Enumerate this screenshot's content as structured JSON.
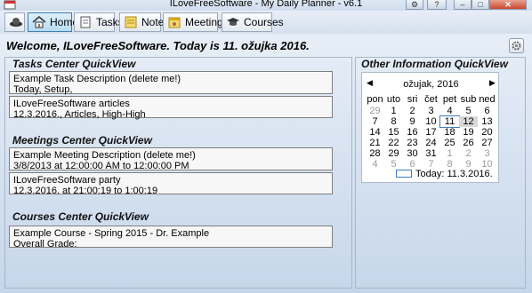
{
  "window": {
    "title": "ILoveFreeSoftware - My Daily Planner - v6.1"
  },
  "toolbar": {
    "buttons": [
      {
        "label": "Home",
        "icon": "home-icon"
      },
      {
        "label": "Tasks",
        "icon": "tasks-icon"
      },
      {
        "label": "Notes",
        "icon": "notes-icon"
      },
      {
        "label": "Meetings",
        "icon": "meetings-icon"
      },
      {
        "label": "Courses",
        "icon": "courses-icon"
      }
    ]
  },
  "welcome": "Welcome, ILoveFreeSoftware. Today is 11. ožujka 2016.",
  "tasks": {
    "title": "Tasks Center QuickView",
    "items": [
      {
        "line1": "Example Task Description (delete me!)",
        "line2": "Today, Setup,"
      },
      {
        "line1": "ILoveFreeSoftware articles",
        "line2": "12.3.2016., Articles, High-High"
      }
    ]
  },
  "meetings": {
    "title": "Meetings Center QuickView",
    "items": [
      {
        "line1": "Example Meeting Description (delete me!)",
        "line2": "3/8/2013 at 12:00:00 AM to 12:00:00 PM"
      },
      {
        "line1": "ILoveFreeSoftware party",
        "line2": "12.3.2016. at 21:00:19 to 1:00:19"
      }
    ]
  },
  "courses": {
    "title": "Courses Center QuickView",
    "items": [
      {
        "line1": "Example Course - Spring 2015 - Dr. Example",
        "line2": "Overall Grade:"
      }
    ]
  },
  "other": {
    "title": "Other Information QuickView",
    "calendar": {
      "month_label": "ožujak, 2016",
      "weekdays": [
        "pon",
        "uto",
        "sri",
        "čet",
        "pet",
        "sub",
        "ned"
      ],
      "weeks": [
        [
          "29",
          "1",
          "2",
          "3",
          "4",
          "5",
          "6"
        ],
        [
          "7",
          "8",
          "9",
          "10",
          "11",
          "12",
          "13"
        ],
        [
          "14",
          "15",
          "16",
          "17",
          "18",
          "19",
          "20"
        ],
        [
          "21",
          "22",
          "23",
          "24",
          "25",
          "26",
          "27"
        ],
        [
          "28",
          "29",
          "30",
          "31",
          "1",
          "2",
          "3"
        ],
        [
          "4",
          "5",
          "6",
          "7",
          "8",
          "9",
          "10"
        ]
      ],
      "today_label": "Today: 11.3.2016."
    }
  }
}
